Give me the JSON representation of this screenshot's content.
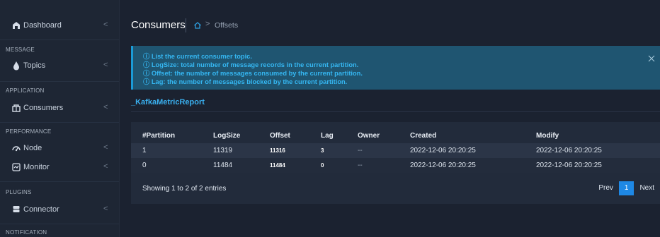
{
  "sidebar": {
    "dashboard": "Dashboard",
    "sections": {
      "message": "MESSAGE",
      "application": "APPLICATION",
      "performance": "PERFORMANCE",
      "plugins": "PLUGINS",
      "notification": "NOTIFICATION"
    },
    "items": {
      "topics": "Topics",
      "consumers": "Consumers",
      "node": "Node",
      "monitor": "Monitor",
      "connector": "Connector"
    },
    "chevron": "<"
  },
  "header": {
    "title": "Consumers",
    "breadcrumb_sep": ">",
    "breadcrumb": "Offsets"
  },
  "alert": {
    "lines": [
      "ⓘ List the current consumer topic.",
      "ⓘ LogSize: total number of message records in the current partition.",
      "ⓘ Offset: the number of messages consumed by the current partition.",
      "ⓘ Lag: the number of messages blocked by the current partition."
    ],
    "close": "×"
  },
  "section": {
    "title": "_KafkaMetricReport"
  },
  "table": {
    "headers": [
      "#Partition",
      "LogSize",
      "Offset",
      "Lag",
      "Owner",
      "Created",
      "Modify"
    ],
    "rows": [
      [
        "1",
        "11319",
        "11316",
        "3",
        "--",
        "2022-12-06 20:20:25",
        "2022-12-06 20:20:25"
      ],
      [
        "0",
        "11484",
        "11484",
        "0",
        "--",
        "2022-12-06 20:20:25",
        "2022-12-06 20:20:25"
      ]
    ]
  },
  "footer": {
    "showing": "Showing 1 to 2 of 2 entries",
    "prev": "Prev",
    "page": "1",
    "next": "Next"
  },
  "colors": {
    "accent": "#35b7f2",
    "active_page": "#1e88e5",
    "alert_bg": "#1f5571"
  }
}
